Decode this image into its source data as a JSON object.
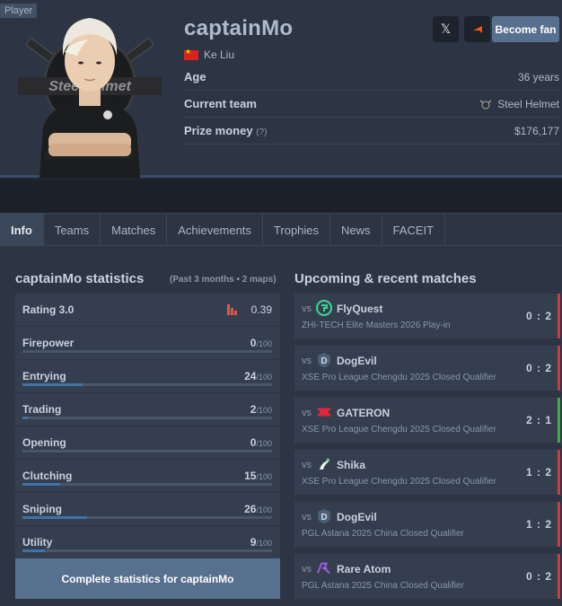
{
  "player": {
    "tag": "Player",
    "nickname": "captainMo",
    "real_name": "Ke Liu",
    "age_label": "Age",
    "age_value": "36 years",
    "team_label": "Current team",
    "team_value": "Steel Helmet",
    "prize_label": "Prize money",
    "prize_hint": "(?)",
    "prize_value": "$176,177",
    "social": [
      "x-icon",
      "faceit-icon"
    ],
    "fan_button": "Become fan",
    "team_logo_text": "SteelHelmet"
  },
  "tabs": [
    "Info",
    "Teams",
    "Matches",
    "Achievements",
    "Trophies",
    "News",
    "FACEIT"
  ],
  "stats": {
    "title": "captainMo statistics",
    "period": "(Past 3 months • 2 maps)",
    "rating_label": "Rating 3.0",
    "rating_value": "0.39",
    "rows": [
      {
        "name": "Firepower",
        "value": "0",
        "max": "/100",
        "pct": 0
      },
      {
        "name": "Entrying",
        "value": "24",
        "max": "/100",
        "pct": 24
      },
      {
        "name": "Trading",
        "value": "2",
        "max": "/100",
        "pct": 2
      },
      {
        "name": "Opening",
        "value": "0",
        "max": "/100",
        "pct": 0
      },
      {
        "name": "Clutching",
        "value": "15",
        "max": "/100",
        "pct": 15
      },
      {
        "name": "Sniping",
        "value": "26",
        "max": "/100",
        "pct": 26
      },
      {
        "name": "Utility",
        "value": "9",
        "max": "/100",
        "pct": 9
      }
    ],
    "complete_button": "Complete statistics for captainMo"
  },
  "matches": {
    "title": "Upcoming & recent matches",
    "vs": "vs",
    "items": [
      {
        "team": "FlyQuest",
        "event": "ZHI-TECH Elite Masters 2026 Play-in",
        "score": "0 : 2",
        "result": "loss",
        "logo": "flyquest-logo-icon"
      },
      {
        "team": "DogEvil",
        "event": "XSE Pro League Chengdu 2025 Closed Qualifier",
        "score": "0 : 2",
        "result": "loss",
        "logo": "dogevil-logo-icon"
      },
      {
        "team": "GATERON",
        "event": "XSE Pro League Chengdu 2025 Closed Qualifier",
        "score": "2 : 1",
        "result": "win",
        "logo": "gateron-logo-icon"
      },
      {
        "team": "Shika",
        "event": "XSE Pro League Chengdu 2025 Closed Qualifier",
        "score": "1 : 2",
        "result": "loss",
        "logo": "shika-logo-icon"
      },
      {
        "team": "DogEvil",
        "event": "PGL Astana 2025 China Closed Qualifier",
        "score": "1 : 2",
        "result": "loss",
        "logo": "dogevil-logo-icon"
      },
      {
        "team": "Rare Atom",
        "event": "PGL Astana 2025 China Closed Qualifier",
        "score": "0 : 2",
        "result": "loss",
        "logo": "rareatom-logo-icon"
      }
    ]
  },
  "colors": {
    "win": "#3fae3f",
    "loss": "#d23a3a",
    "accent": "#58708f",
    "bar": "#3e73a8"
  }
}
